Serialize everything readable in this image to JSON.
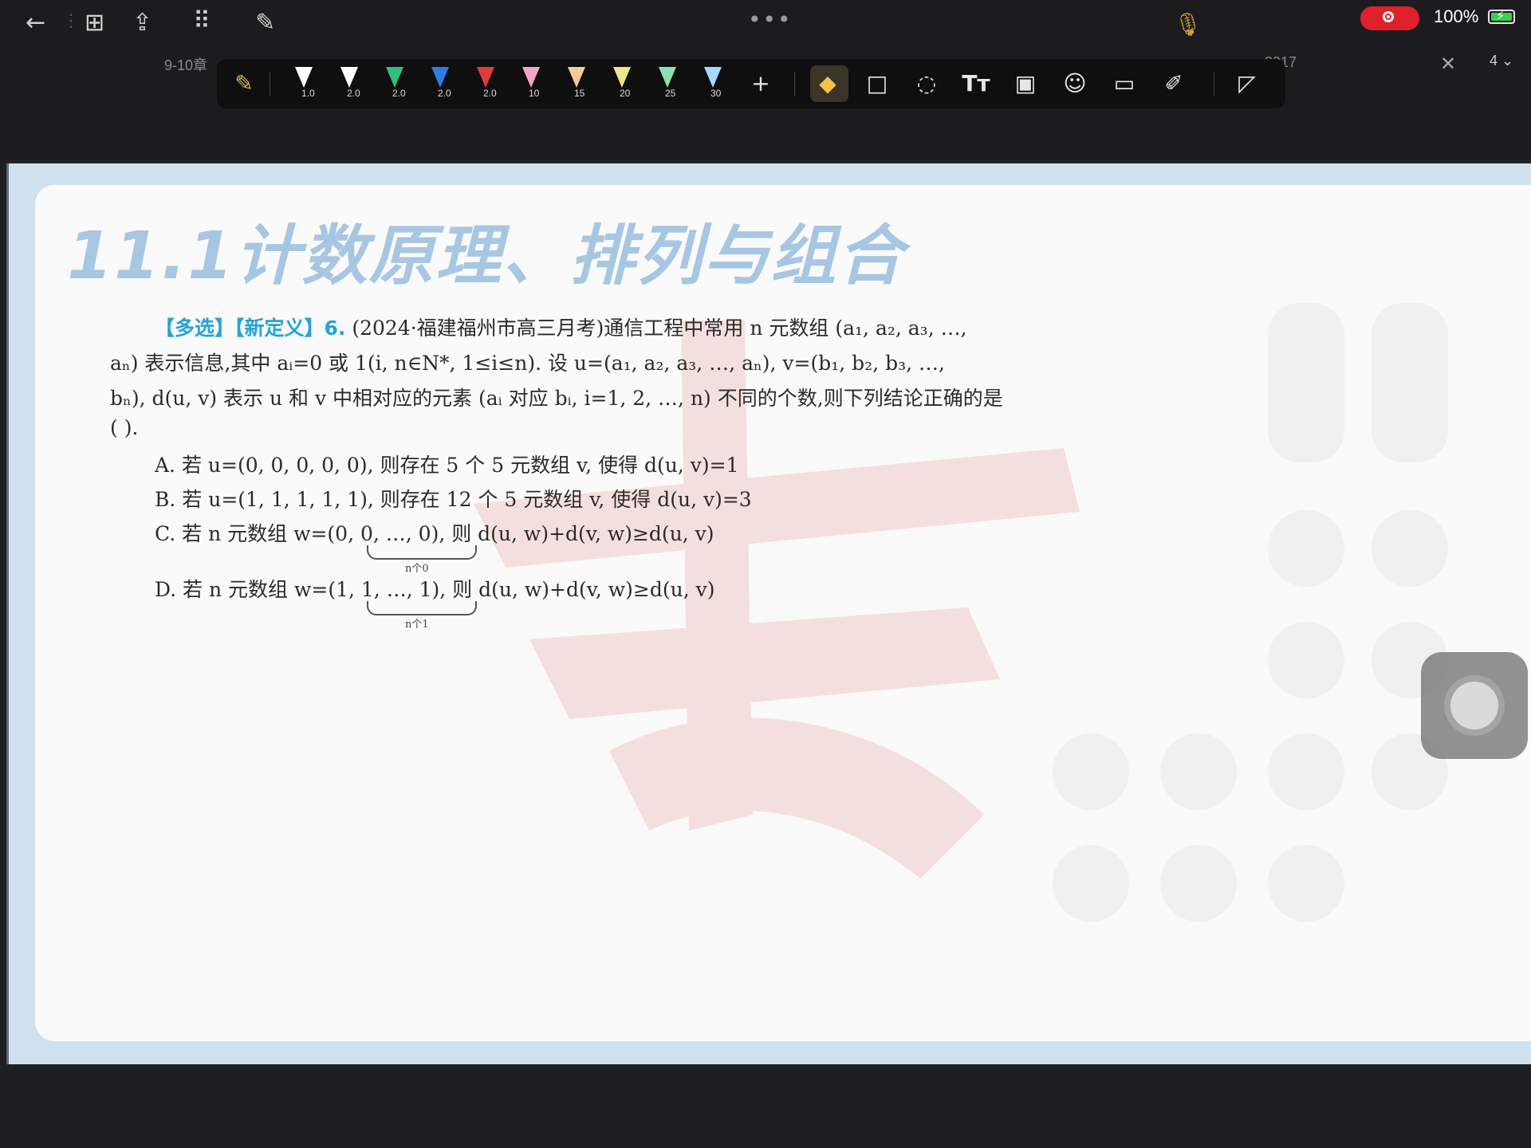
{
  "status_bar": {
    "battery": "100%"
  },
  "tabs": {
    "left_tab": "9-10章",
    "right_tab": "2017",
    "page_number": "4"
  },
  "toolbar": {
    "pens": [
      {
        "size": "1.0",
        "color": "#ffffff"
      },
      {
        "size": "2.0",
        "color": "#ffffff"
      },
      {
        "size": "2.0",
        "color": "#2fbf7a"
      },
      {
        "size": "2.0",
        "color": "#2f7de0"
      },
      {
        "size": "2.0",
        "color": "#e23b3b"
      },
      {
        "size": "10",
        "color": "#f4a6c8"
      },
      {
        "size": "15",
        "color": "#f6c99a"
      },
      {
        "size": "20",
        "color": "#e9e88a"
      },
      {
        "size": "25",
        "color": "#8fe0b0"
      },
      {
        "size": "30",
        "color": "#a8d8f6"
      }
    ],
    "add_label": "+"
  },
  "document": {
    "section_title": "11.1计数原理、排列与组合",
    "question": {
      "tags": "【多选】【新定义】6.",
      "line1": "(2024·福建福州市高三月考)通信工程中常用 n 元数组 (a₁, a₂, a₃, …,",
      "line2": "aₙ) 表示信息,其中 aᵢ=0 或 1(i, n∈N*, 1≤i≤n). 设 u=(a₁, a₂, a₃, …, aₙ), v=(b₁, b₂, b₃, …,",
      "line3": "bₙ), d(u, v) 表示 u 和 v 中相对应的元素 (aᵢ 对应 bᵢ, i=1, 2, …, n) 不同的个数,则下列结论正确的是",
      "line4": "(        ).",
      "options": [
        {
          "label": "A.",
          "text": "若 u=(0, 0, 0, 0, 0), 则存在 5 个 5 元数组 v, 使得 d(u, v)=1"
        },
        {
          "label": "B.",
          "text": "若 u=(1, 1, 1, 1, 1), 则存在 12 个 5 元数组 v, 使得 d(u, v)=3"
        },
        {
          "label": "C.",
          "text": "若 n 元数组 w=(0, 0, …, 0), 则 d(u, w)+d(v, w)≥d(u, v)",
          "brace_label": "n个0"
        },
        {
          "label": "D.",
          "text": "若 n 元数组 w=(1, 1, …, 1), 则 d(u, w)+d(v, w)≥d(u, v)",
          "brace_label": "n个1"
        }
      ]
    }
  },
  "colors": {
    "tag_blue": "#27a3d6",
    "title_blue": "#a7c6e2",
    "accent_eraser": "#f2c24a",
    "record_red": "#e0202a"
  }
}
